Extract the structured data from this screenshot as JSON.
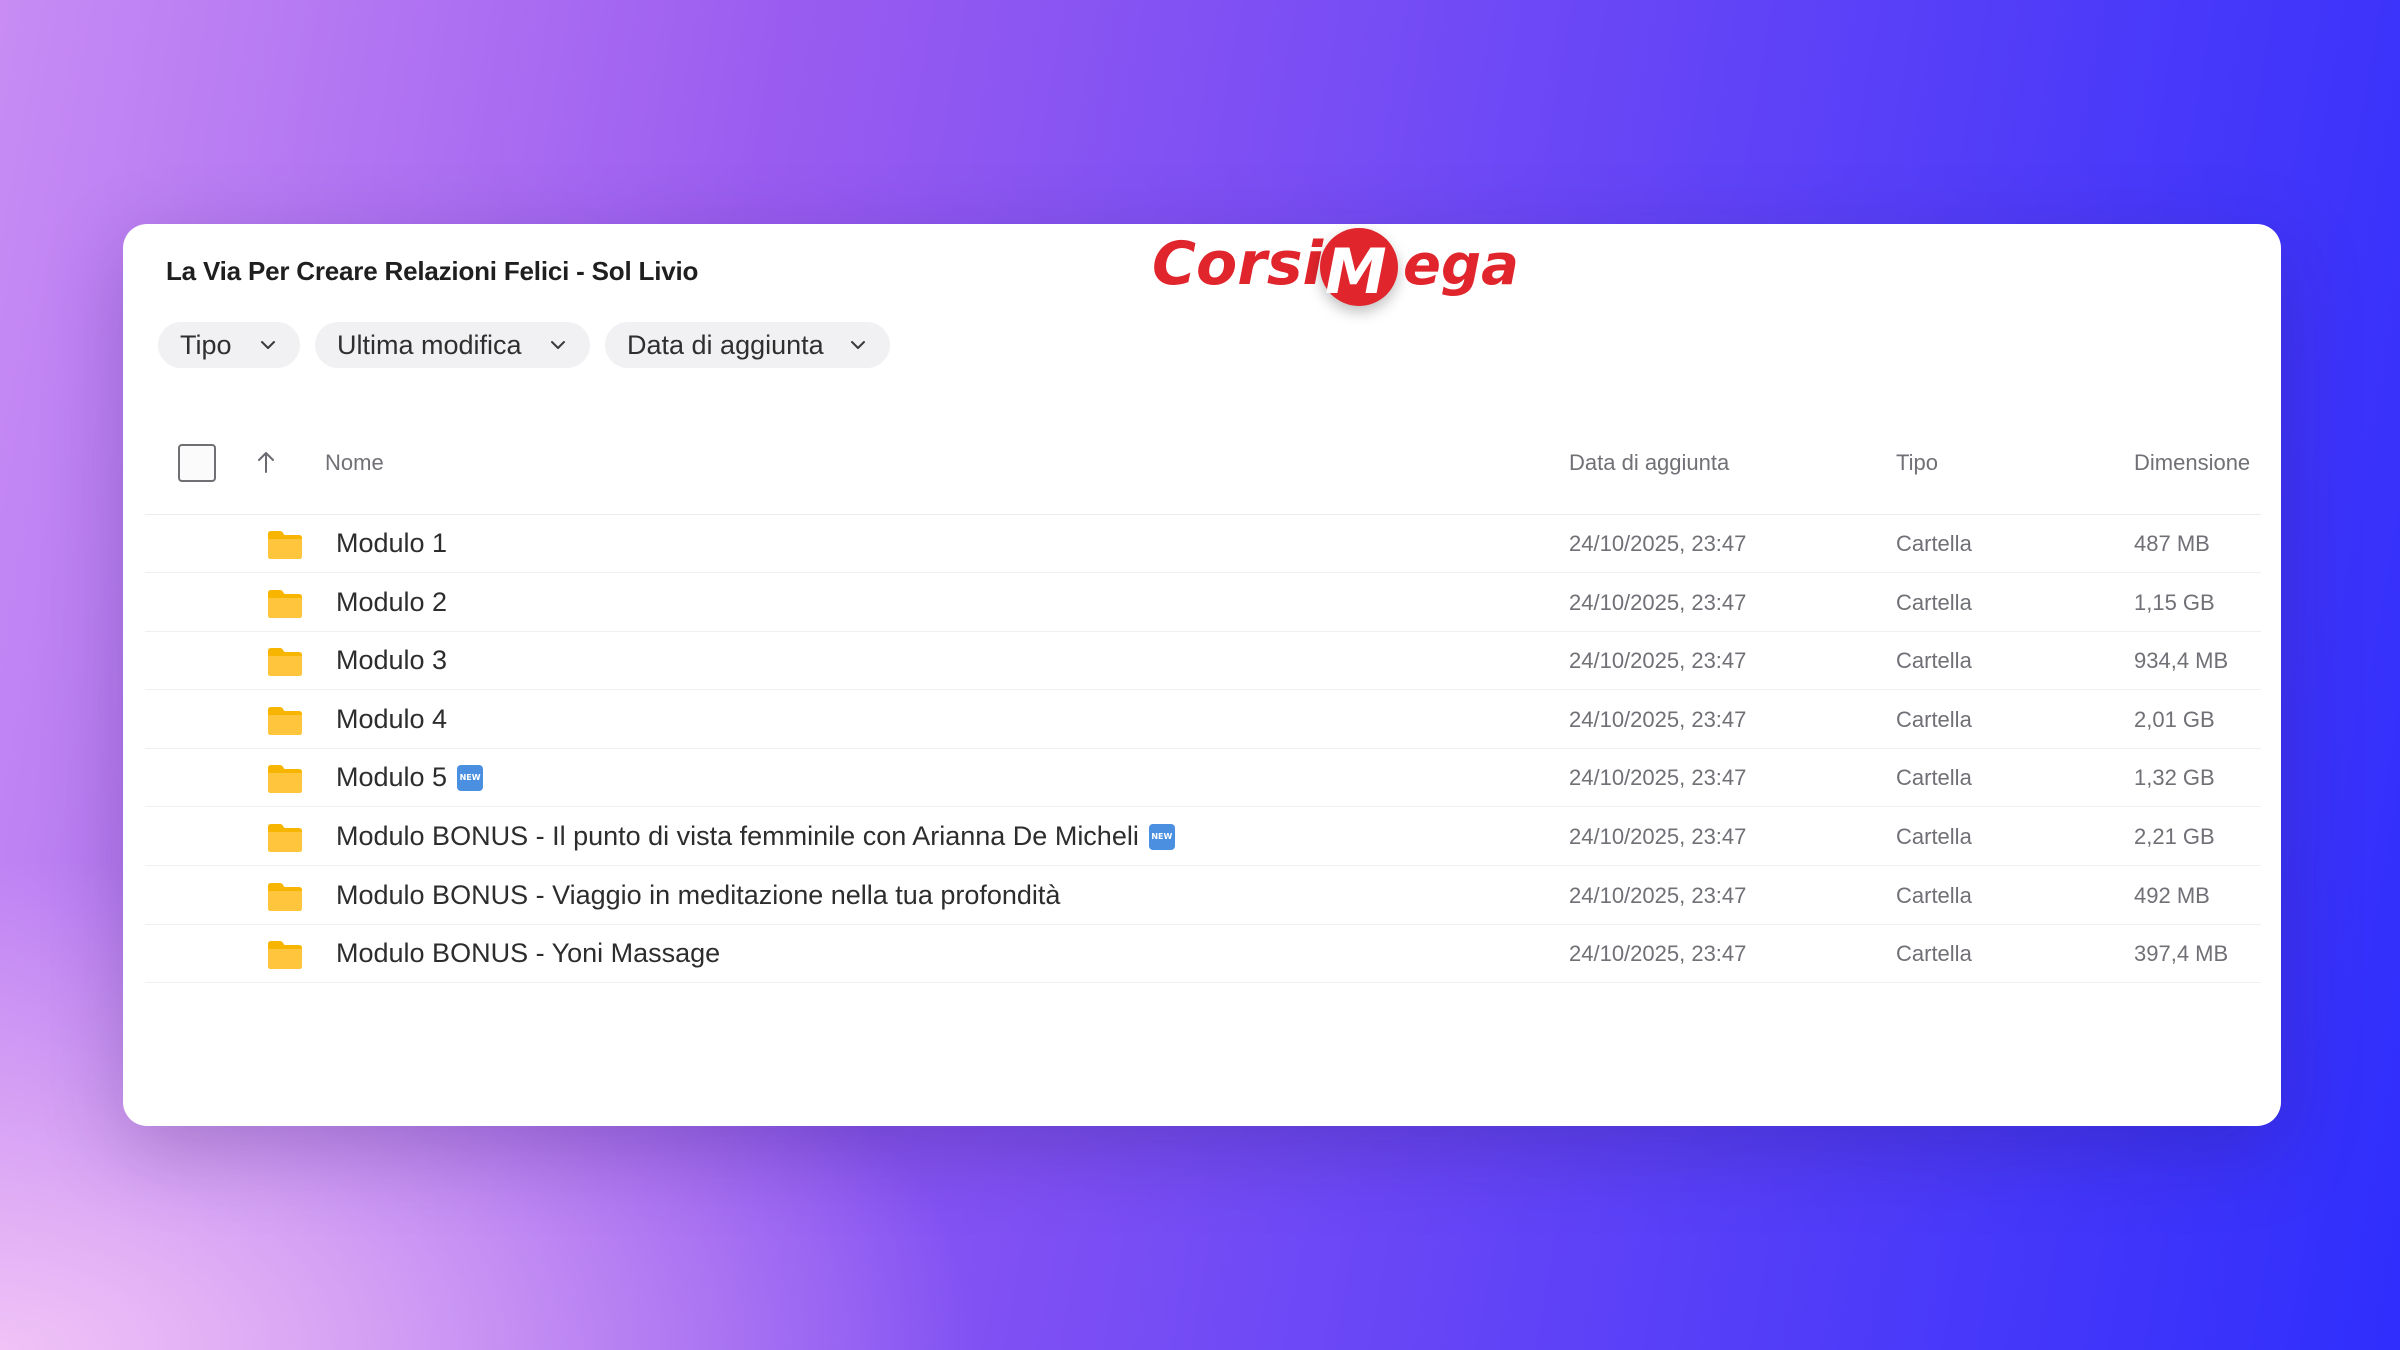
{
  "window": {
    "title": "La Via Per Creare Relazioni Felici - Sol Livio"
  },
  "logo": {
    "text_left": "Corsi",
    "text_circle": "M",
    "text_right": "ega",
    "color": "#e0252c"
  },
  "filters": [
    {
      "label": "Tipo"
    },
    {
      "label": "Ultima modifica"
    },
    {
      "label": "Data di aggiunta"
    }
  ],
  "columns": {
    "name": "Nome",
    "date": "Data di aggiunta",
    "type": "Tipo",
    "size": "Dimensione"
  },
  "rows": [
    {
      "name": "Modulo 1",
      "new": false,
      "date": "24/10/2025, 23:47",
      "type": "Cartella",
      "size": "487 MB"
    },
    {
      "name": "Modulo 2",
      "new": false,
      "date": "24/10/2025, 23:47",
      "type": "Cartella",
      "size": "1,15 GB"
    },
    {
      "name": "Modulo 3",
      "new": false,
      "date": "24/10/2025, 23:47",
      "type": "Cartella",
      "size": "934,4 MB"
    },
    {
      "name": "Modulo 4",
      "new": false,
      "date": "24/10/2025, 23:47",
      "type": "Cartella",
      "size": "2,01 GB"
    },
    {
      "name": "Modulo 5",
      "new": true,
      "date": "24/10/2025, 23:47",
      "type": "Cartella",
      "size": "1,32 GB"
    },
    {
      "name": "Modulo BONUS - Il punto di vista femminile con Arianna De Micheli",
      "new": true,
      "date": "24/10/2025, 23:47",
      "type": "Cartella",
      "size": "2,21 GB"
    },
    {
      "name": "Modulo BONUS - Viaggio in meditazione nella tua profondità",
      "new": false,
      "date": "24/10/2025, 23:47",
      "type": "Cartella",
      "size": "492 MB"
    },
    {
      "name": "Modulo BONUS - Yoni Massage",
      "new": false,
      "date": "24/10/2025, 23:47",
      "type": "Cartella",
      "size": "397,4 MB"
    }
  ],
  "new_badge_label": "NEW",
  "icons": {
    "folder": "folder-icon",
    "sort": "arrow-up-icon",
    "chevron": "chevron-down-icon"
  },
  "colors": {
    "folder": "#f7b500",
    "new_badge": "#4a8fe0"
  }
}
